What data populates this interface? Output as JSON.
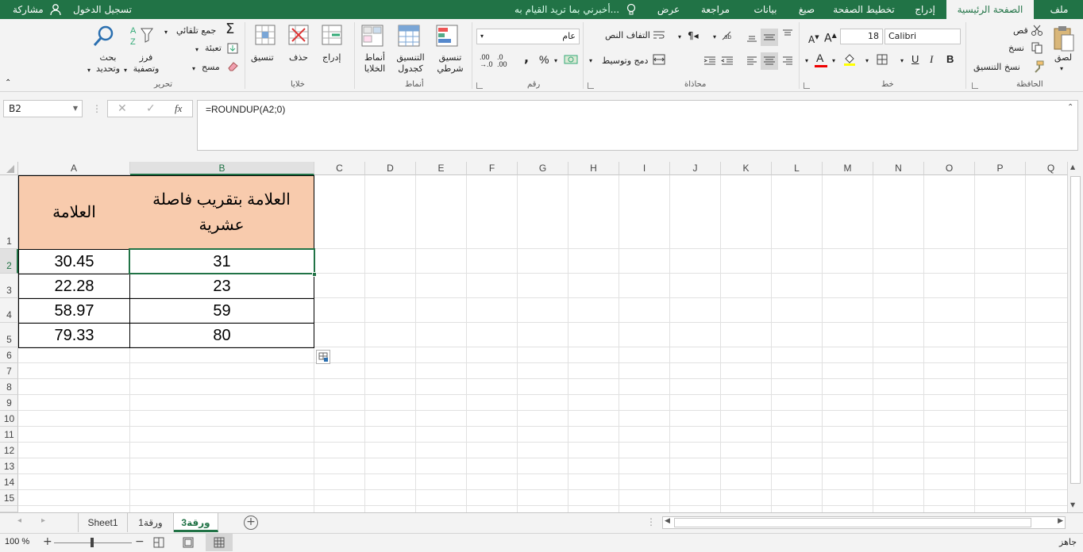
{
  "topbar": {
    "tabs": [
      "ملف",
      "الصفحة الرئيسية",
      "إدراج",
      "تخطيط الصفحة",
      "صيغ",
      "بيانات",
      "مراجعة",
      "عرض"
    ],
    "tell_me": "أخبرني بما تريد القيام به...",
    "signin": "تسجيل الدخول",
    "share": "مشاركة"
  },
  "ribbon": {
    "clipboard": {
      "paste": "لصق",
      "cut": "قص",
      "copy": "نسخ",
      "format_painter": "نسخ التنسيق",
      "group": "الحافظة"
    },
    "font": {
      "name": "Calibri",
      "size": "18",
      "group": "خط"
    },
    "alignment": {
      "wrap": "التفاف النص",
      "merge": "دمج وتوسيط",
      "group": "محاذاة"
    },
    "number": {
      "format": "عام",
      "group": "رقم"
    },
    "styles": {
      "conditional": "تنسيق شرطي",
      "as_table": "التنسيق كجدول",
      "cell_styles": "أنماط الخلايا",
      "group": "أنماط"
    },
    "cells": {
      "insert": "إدراج",
      "delete": "حذف",
      "format": "تنسيق",
      "group": "خلايا"
    },
    "editing": {
      "autosum": "جمع تلقائي",
      "fill": "تعبئة",
      "clear": "مسح",
      "sort": "فرز وتصفية",
      "find": "بحث وتحديد",
      "group": "تحرير"
    }
  },
  "formula_bar": {
    "name_box": "B2",
    "formula": "=ROUNDUP(A2;0)",
    "fx": "fx"
  },
  "columns": [
    "A",
    "B",
    "C",
    "D",
    "E",
    "F",
    "G",
    "H",
    "I",
    "J",
    "K",
    "L",
    "M",
    "N",
    "O",
    "P",
    "Q"
  ],
  "rows": [
    "1",
    "2",
    "3",
    "4",
    "5",
    "6",
    "7",
    "8",
    "9",
    "10",
    "11",
    "12",
    "13",
    "14",
    "15"
  ],
  "table": {
    "header_a": "العلامة",
    "header_b": "العلامة بتقريب فاصلة عشرية",
    "rows": [
      {
        "a": "30.45",
        "b": "31"
      },
      {
        "a": "22.28",
        "b": "23"
      },
      {
        "a": "58.97",
        "b": "59"
      },
      {
        "a": "79.33",
        "b": "80"
      }
    ]
  },
  "sheets": [
    "Sheet1",
    "ورقة1",
    "ورقة3"
  ],
  "status": {
    "ready": "جاهز",
    "zoom": "100 %"
  },
  "colors": {
    "accent": "#217346",
    "header_fill": "#f8cbad"
  }
}
